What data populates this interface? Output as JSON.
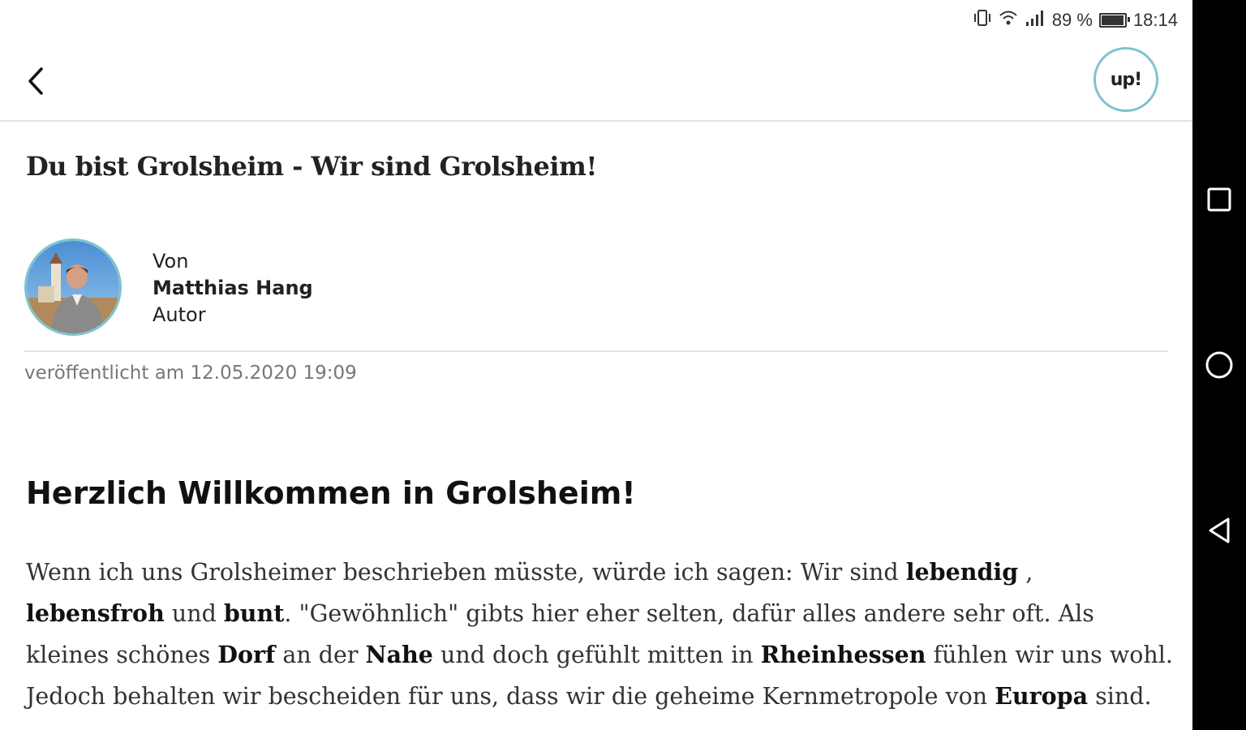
{
  "status_bar": {
    "battery_percent": "89 %",
    "battery_level": 0.89,
    "time": "18:14"
  },
  "app_bar": {
    "up_label": "up!"
  },
  "article": {
    "title": "Du bist Grolsheim - Wir sind Grolsheim!",
    "author": {
      "by_label": "Von",
      "name": "Matthias Hang",
      "role": "Autor"
    },
    "published": "veröffentlicht am 12.05.2020 19:09",
    "heading": "Herzlich Willkommen in Grolsheim!",
    "paragraph": [
      {
        "text": "Wenn ich uns Grolsheimer beschrieben müsste, würde ich sagen: Wir sind ",
        "bold": false
      },
      {
        "text": "lebendig",
        "bold": true
      },
      {
        "text": " , ",
        "bold": false
      },
      {
        "text": "lebensfroh",
        "bold": true
      },
      {
        "text": " und ",
        "bold": false
      },
      {
        "text": "bunt",
        "bold": true
      },
      {
        "text": ". \"Gewöhnlich\" gibts hier eher selten, dafür alles andere sehr oft. Als kleines schönes ",
        "bold": false
      },
      {
        "text": "Dorf",
        "bold": true
      },
      {
        "text": " an der ",
        "bold": false
      },
      {
        "text": "Nahe",
        "bold": true
      },
      {
        "text": " und doch gefühlt mitten in ",
        "bold": false
      },
      {
        "text": "Rheinhessen",
        "bold": true
      },
      {
        "text": " fühlen wir uns wohl. Jedoch behalten wir bescheiden für uns, dass wir die geheime Kernmetropole von ",
        "bold": false
      },
      {
        "text": "Europa",
        "bold": true
      },
      {
        "text": " sind.",
        "bold": false
      }
    ]
  },
  "icons": {
    "back": "back-arrow-icon",
    "vibrate": "vibrate-icon",
    "wifi": "wifi-icon",
    "signal": "signal-icon",
    "battery": "battery-icon",
    "recents": "recents-square-icon",
    "home": "home-circle-icon",
    "nav_back": "back-triangle-icon"
  },
  "colors": {
    "accent": "#7ec3cf",
    "nav_bar": "#000000"
  }
}
